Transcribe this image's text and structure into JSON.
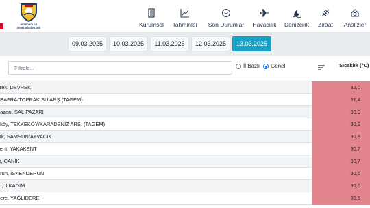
{
  "brand": {
    "logo_line1": "METEOROLOJİ",
    "logo_line2": "GENEL MÜDÜRLÜĞÜ",
    "accent": "#c8102e",
    "navy": "#1b3a6b"
  },
  "nav": {
    "items": [
      {
        "label": "Kurumsal",
        "icon": "document-icon"
      },
      {
        "label": "Tahminler",
        "icon": "chart-line-icon"
      },
      {
        "label": "Son Durumlar",
        "icon": "clock-icon"
      },
      {
        "label": "Havacılık",
        "icon": "airplane-icon"
      },
      {
        "label": "Denizcilik",
        "icon": "wave-icon"
      },
      {
        "label": "Ziraat",
        "icon": "leaf-icon"
      },
      {
        "label": "Analizler",
        "icon": "analysis-icon"
      }
    ]
  },
  "dates": {
    "tabs": [
      "09.03.2025",
      "10.03.2025",
      "11.03.2025",
      "12.03.2025",
      "13.03.2025"
    ],
    "active_index": 4,
    "active_color": "#17a2c8"
  },
  "filter": {
    "placeholder": "Filtrele...",
    "value": "",
    "option_province": "İl Bazlı",
    "option_general": "Genel",
    "selected": "Genel"
  },
  "table": {
    "column_header": "Sıcaklık (°C)",
    "value_color": "#e3858c",
    "rows": [
      {
        "name": "vrek, DEVREK",
        "value": "32,0"
      },
      {
        "name": ", BAFRA/TOPRAK SU ARŞ.(TAGEM)",
        "value": "31,4"
      },
      {
        "name": "pazarı, SALIPAZARI",
        "value": "30,9"
      },
      {
        "name": "eköy, TEKKEKÖY/KARADENİZ ARŞ. (TAGEM)",
        "value": "30,9"
      },
      {
        "name": "cık, SAMSUN/AYVACIK",
        "value": "30,8"
      },
      {
        "name": "kent, YAKAKENT",
        "value": "30,7"
      },
      {
        "name": "ik, CANİK",
        "value": "30,7"
      },
      {
        "name": "erun, İSKENDERUN",
        "value": "30,6"
      },
      {
        "name": "m, İLKADIM",
        "value": "30,6"
      },
      {
        "name": "dere, YAĞLIDERE",
        "value": "30,5"
      }
    ]
  }
}
